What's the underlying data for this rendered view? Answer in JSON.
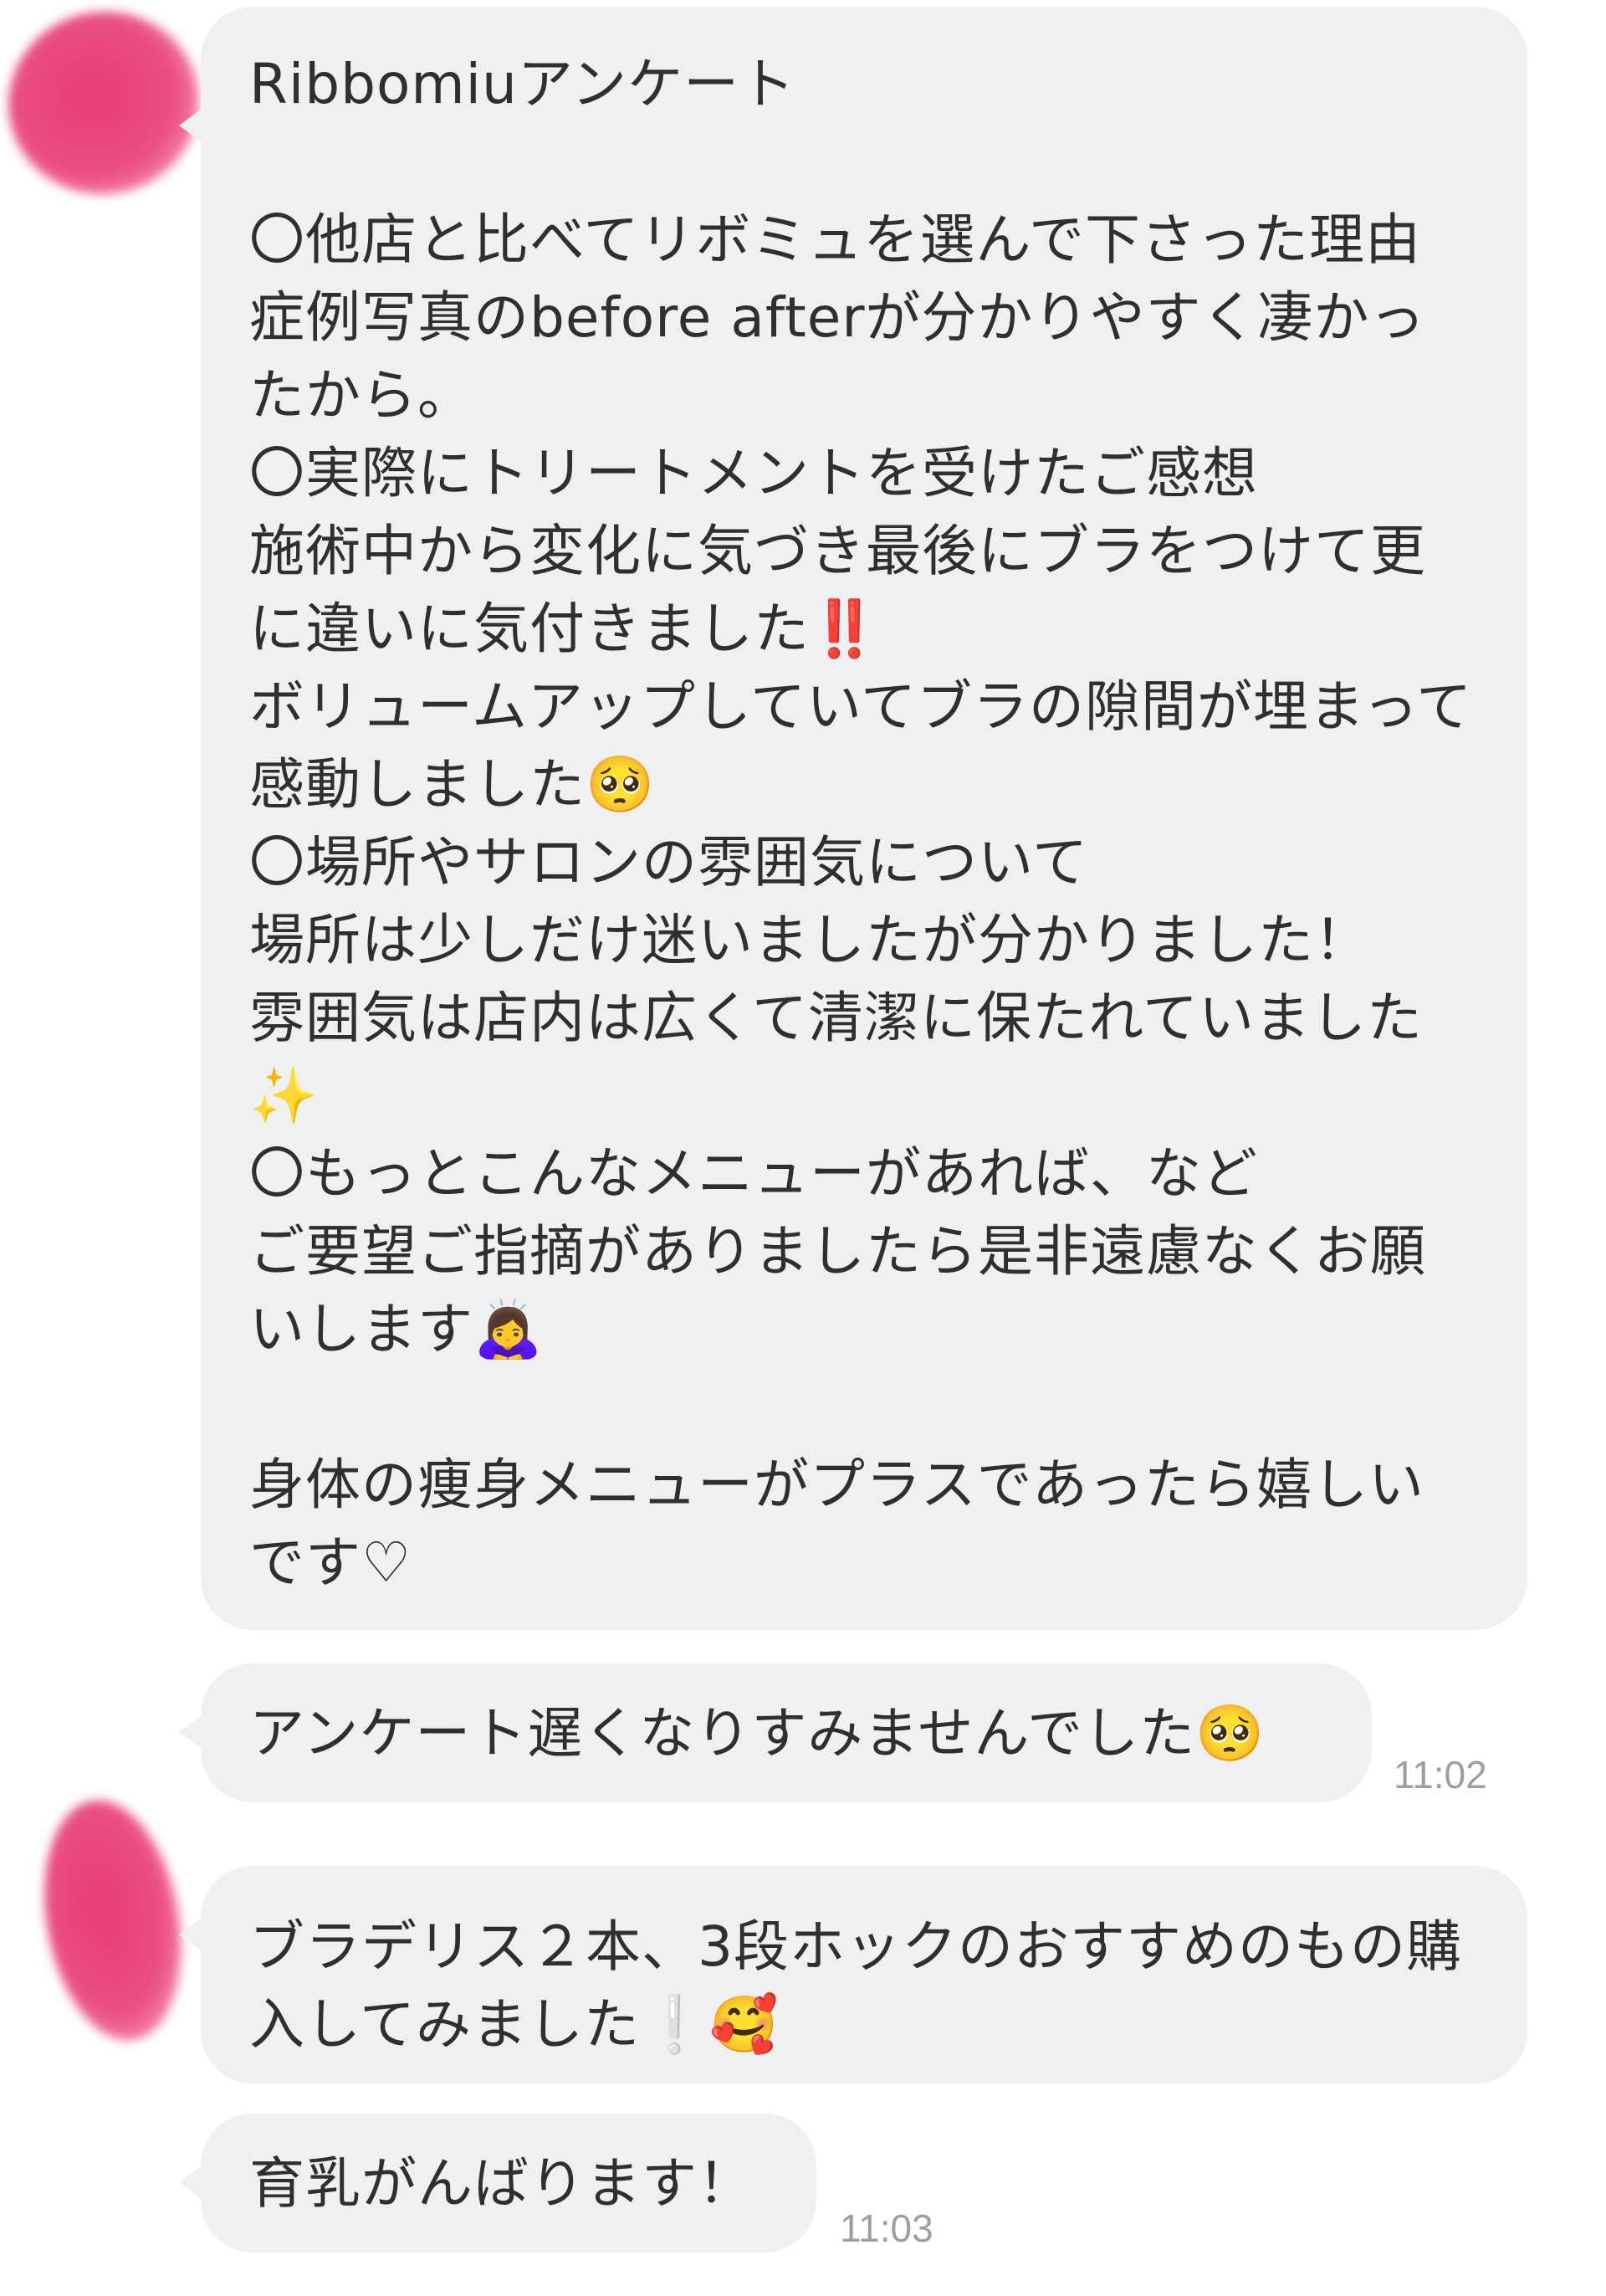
{
  "conversation": {
    "messages": [
      {
        "text": "Ribbomiuアンケート\n\n〇他店と比べてリボミュを選んで下さった理由\n症例写真のbefore afterが分かりやすく凄かったから。\n〇実際にトリートメントを受けたご感想\n施術中から変化に気づき最後にブラをつけて更に違いに気付きました‼️\nボリュームアップしていてブラの隙間が埋まって感動しました🥺\n〇場所やサロンの雰囲気について\n場所は少しだけ迷いましたが分かりました！\n雰囲気は店内は広くて清潔に保たれていました✨\n〇もっとこんなメニューがあれば、など\nご要望ご指摘がありましたら是非遠慮なくお願いします🙇‍♀️\n\n身体の痩身メニューがプラスであったら嬉しいです♡"
      },
      {
        "text": "アンケート遅くなりすみませんでした🥺",
        "time": "11:02"
      },
      {
        "text": "ブラデリス２本、3段ホックのおすすめのもの購入してみました❕🥰"
      },
      {
        "text": "育乳がんばります！",
        "time": "11:03"
      }
    ]
  },
  "colors": {
    "bubble": "#eff0f2",
    "text": "#2f2f2f",
    "timestamp": "#9a9ea6",
    "avatar": "#e63c74"
  },
  "icons": [
    "avatar-blurred"
  ]
}
